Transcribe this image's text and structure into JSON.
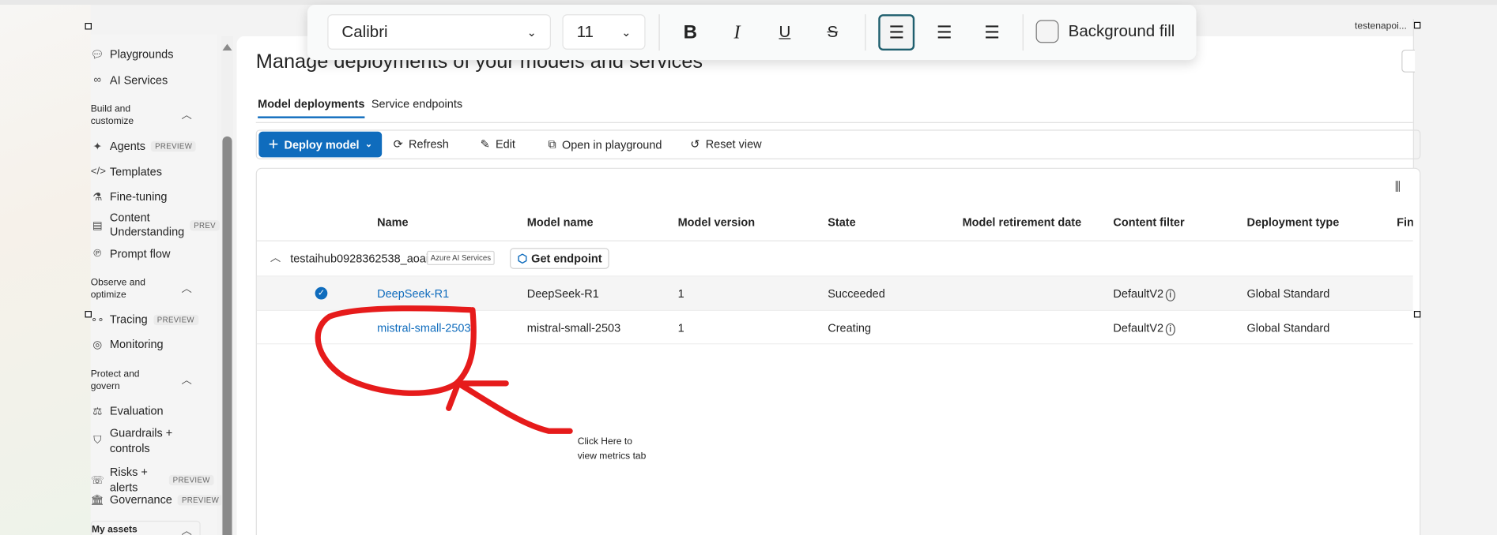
{
  "sidebar": {
    "items": [
      {
        "label": "Playgrounds",
        "icon": "chat-icon"
      },
      {
        "label": "AI Services",
        "icon": "ai-services-icon"
      }
    ],
    "sections": [
      {
        "title": "Build and customize",
        "items": [
          {
            "label": "Agents",
            "badge": "PREVIEW"
          },
          {
            "label": "Templates"
          },
          {
            "label": "Fine-tuning"
          },
          {
            "label": "Content Understanding",
            "badge": "PREV"
          },
          {
            "label": "Prompt flow"
          }
        ]
      },
      {
        "title": "Observe and optimize",
        "items": [
          {
            "label": "Tracing",
            "badge": "PREVIEW"
          },
          {
            "label": "Monitoring"
          }
        ]
      },
      {
        "title": "Protect and govern",
        "items": [
          {
            "label": "Evaluation"
          },
          {
            "label": "Guardrails + controls"
          },
          {
            "label": "Risks + alerts",
            "badge": "PREVIEW"
          },
          {
            "label": "Governance",
            "badge": "PREVIEW"
          }
        ]
      },
      {
        "title": "My assets"
      }
    ]
  },
  "header": {
    "user": "testenapoi..."
  },
  "main": {
    "title": "Manage deployments of your models and services",
    "tabs": [
      {
        "label": "Model deployments",
        "active": true
      },
      {
        "label": "Service endpoints"
      }
    ],
    "commands": {
      "deploy": "Deploy model",
      "refresh": "Refresh",
      "edit": "Edit",
      "playground": "Open in playground",
      "reset": "Reset view"
    },
    "table": {
      "columns": [
        "Name",
        "Model name",
        "Model version",
        "State",
        "Model retirement date",
        "Content filter",
        "Deployment type",
        "Fin"
      ],
      "group": {
        "name": "testaihub0928362538_aoai",
        "badge": "Azure AI Services",
        "action": "Get endpoint"
      },
      "rows": [
        {
          "name": "DeepSeek-R1",
          "model": "DeepSeek-R1",
          "version": "1",
          "state": "Succeeded",
          "retirement": "",
          "filter": "DefaultV2",
          "type": "Global Standard",
          "selected": true
        },
        {
          "name": "mistral-small-2503",
          "model": "mistral-small-2503",
          "version": "1",
          "state": "Creating",
          "retirement": "",
          "filter": "DefaultV2",
          "type": "Global Standard",
          "selected": false
        }
      ]
    }
  },
  "format_toolbar": {
    "font": "Calibri",
    "size": "11",
    "bold": "B",
    "italic": "I",
    "underline": "U",
    "strike": "S",
    "background_fill": "Background fill"
  },
  "annotation": {
    "text_line1": "Click Here to",
    "text_line2": "view metrics tab",
    "color": "#e61b1b"
  }
}
